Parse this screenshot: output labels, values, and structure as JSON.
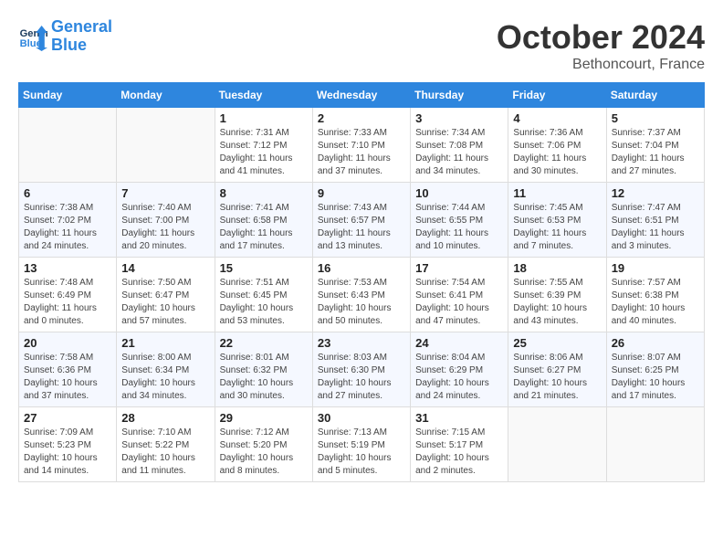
{
  "header": {
    "logo_line1": "General",
    "logo_line2": "Blue",
    "month": "October 2024",
    "location": "Bethoncourt, France"
  },
  "weekdays": [
    "Sunday",
    "Monday",
    "Tuesday",
    "Wednesday",
    "Thursday",
    "Friday",
    "Saturday"
  ],
  "weeks": [
    [
      {
        "day": "",
        "info": ""
      },
      {
        "day": "",
        "info": ""
      },
      {
        "day": "1",
        "info": "Sunrise: 7:31 AM\nSunset: 7:12 PM\nDaylight: 11 hours and 41 minutes."
      },
      {
        "day": "2",
        "info": "Sunrise: 7:33 AM\nSunset: 7:10 PM\nDaylight: 11 hours and 37 minutes."
      },
      {
        "day": "3",
        "info": "Sunrise: 7:34 AM\nSunset: 7:08 PM\nDaylight: 11 hours and 34 minutes."
      },
      {
        "day": "4",
        "info": "Sunrise: 7:36 AM\nSunset: 7:06 PM\nDaylight: 11 hours and 30 minutes."
      },
      {
        "day": "5",
        "info": "Sunrise: 7:37 AM\nSunset: 7:04 PM\nDaylight: 11 hours and 27 minutes."
      }
    ],
    [
      {
        "day": "6",
        "info": "Sunrise: 7:38 AM\nSunset: 7:02 PM\nDaylight: 11 hours and 24 minutes."
      },
      {
        "day": "7",
        "info": "Sunrise: 7:40 AM\nSunset: 7:00 PM\nDaylight: 11 hours and 20 minutes."
      },
      {
        "day": "8",
        "info": "Sunrise: 7:41 AM\nSunset: 6:58 PM\nDaylight: 11 hours and 17 minutes."
      },
      {
        "day": "9",
        "info": "Sunrise: 7:43 AM\nSunset: 6:57 PM\nDaylight: 11 hours and 13 minutes."
      },
      {
        "day": "10",
        "info": "Sunrise: 7:44 AM\nSunset: 6:55 PM\nDaylight: 11 hours and 10 minutes."
      },
      {
        "day": "11",
        "info": "Sunrise: 7:45 AM\nSunset: 6:53 PM\nDaylight: 11 hours and 7 minutes."
      },
      {
        "day": "12",
        "info": "Sunrise: 7:47 AM\nSunset: 6:51 PM\nDaylight: 11 hours and 3 minutes."
      }
    ],
    [
      {
        "day": "13",
        "info": "Sunrise: 7:48 AM\nSunset: 6:49 PM\nDaylight: 11 hours and 0 minutes."
      },
      {
        "day": "14",
        "info": "Sunrise: 7:50 AM\nSunset: 6:47 PM\nDaylight: 10 hours and 57 minutes."
      },
      {
        "day": "15",
        "info": "Sunrise: 7:51 AM\nSunset: 6:45 PM\nDaylight: 10 hours and 53 minutes."
      },
      {
        "day": "16",
        "info": "Sunrise: 7:53 AM\nSunset: 6:43 PM\nDaylight: 10 hours and 50 minutes."
      },
      {
        "day": "17",
        "info": "Sunrise: 7:54 AM\nSunset: 6:41 PM\nDaylight: 10 hours and 47 minutes."
      },
      {
        "day": "18",
        "info": "Sunrise: 7:55 AM\nSunset: 6:39 PM\nDaylight: 10 hours and 43 minutes."
      },
      {
        "day": "19",
        "info": "Sunrise: 7:57 AM\nSunset: 6:38 PM\nDaylight: 10 hours and 40 minutes."
      }
    ],
    [
      {
        "day": "20",
        "info": "Sunrise: 7:58 AM\nSunset: 6:36 PM\nDaylight: 10 hours and 37 minutes."
      },
      {
        "day": "21",
        "info": "Sunrise: 8:00 AM\nSunset: 6:34 PM\nDaylight: 10 hours and 34 minutes."
      },
      {
        "day": "22",
        "info": "Sunrise: 8:01 AM\nSunset: 6:32 PM\nDaylight: 10 hours and 30 minutes."
      },
      {
        "day": "23",
        "info": "Sunrise: 8:03 AM\nSunset: 6:30 PM\nDaylight: 10 hours and 27 minutes."
      },
      {
        "day": "24",
        "info": "Sunrise: 8:04 AM\nSunset: 6:29 PM\nDaylight: 10 hours and 24 minutes."
      },
      {
        "day": "25",
        "info": "Sunrise: 8:06 AM\nSunset: 6:27 PM\nDaylight: 10 hours and 21 minutes."
      },
      {
        "day": "26",
        "info": "Sunrise: 8:07 AM\nSunset: 6:25 PM\nDaylight: 10 hours and 17 minutes."
      }
    ],
    [
      {
        "day": "27",
        "info": "Sunrise: 7:09 AM\nSunset: 5:23 PM\nDaylight: 10 hours and 14 minutes."
      },
      {
        "day": "28",
        "info": "Sunrise: 7:10 AM\nSunset: 5:22 PM\nDaylight: 10 hours and 11 minutes."
      },
      {
        "day": "29",
        "info": "Sunrise: 7:12 AM\nSunset: 5:20 PM\nDaylight: 10 hours and 8 minutes."
      },
      {
        "day": "30",
        "info": "Sunrise: 7:13 AM\nSunset: 5:19 PM\nDaylight: 10 hours and 5 minutes."
      },
      {
        "day": "31",
        "info": "Sunrise: 7:15 AM\nSunset: 5:17 PM\nDaylight: 10 hours and 2 minutes."
      },
      {
        "day": "",
        "info": ""
      },
      {
        "day": "",
        "info": ""
      }
    ]
  ]
}
